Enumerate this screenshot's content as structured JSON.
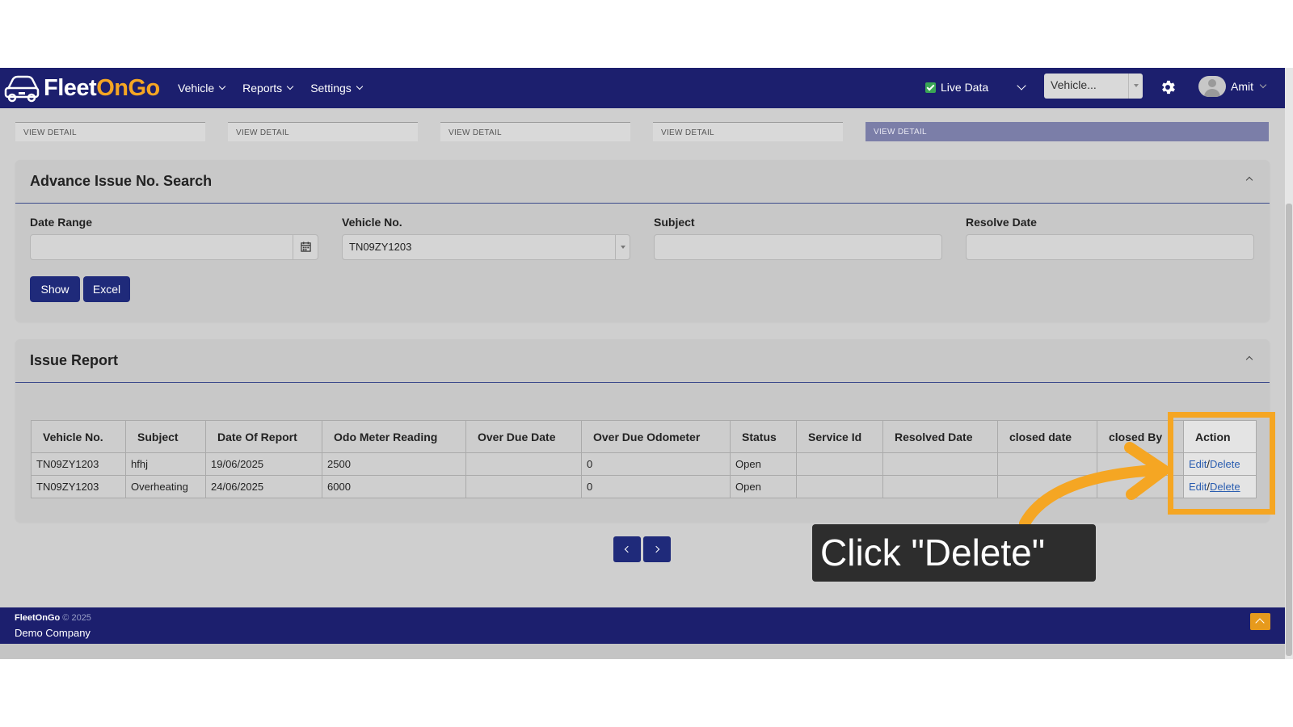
{
  "navbar": {
    "brand_part1": "Fleet",
    "brand_part2": "OnGo",
    "menu": [
      {
        "label": "Vehicle"
      },
      {
        "label": "Reports"
      },
      {
        "label": "Settings"
      }
    ],
    "live_data_label": "Live Data",
    "live_data_checked": true,
    "vehicle_select_value": "Vehicle...",
    "user_name": "Amit"
  },
  "view_detail_tabs": [
    {
      "label": "VIEW DETAIL",
      "active": false
    },
    {
      "label": "VIEW DETAIL",
      "active": false
    },
    {
      "label": "VIEW DETAIL",
      "active": false
    },
    {
      "label": "VIEW DETAIL",
      "active": false
    },
    {
      "label": "VIEW DETAIL",
      "active": true
    }
  ],
  "search": {
    "title": "Advance Issue No. Search",
    "date_range_label": "Date Range",
    "date_range_value": "",
    "vehicle_label": "Vehicle No.",
    "vehicle_value": "TN09ZY1203",
    "subject_label": "Subject",
    "subject_value": "",
    "resolve_label": "Resolve Date",
    "resolve_value": "",
    "show_label": "Show",
    "excel_label": "Excel"
  },
  "report": {
    "title": "Issue Report",
    "columns": [
      "Vehicle No.",
      "Subject",
      "Date Of Report",
      "Odo Meter Reading",
      "Over Due Date",
      "Over Due Odometer",
      "Status",
      "Service Id",
      "Resolved Date",
      "closed date",
      "closed By",
      "Action"
    ],
    "rows": [
      {
        "vehicle": "TN09ZY1203",
        "subject": "hfhj",
        "date": "19/06/2025",
        "odo": "2500",
        "overdue_date": "",
        "overdue_odo": "0",
        "status": "Open",
        "service_id": "",
        "resolved": "",
        "closed_date": "",
        "closed_by": "",
        "edit": "Edit",
        "sep": "/",
        "delete": "Delete"
      },
      {
        "vehicle": "TN09ZY1203",
        "subject": "Overheating",
        "date": "24/06/2025",
        "odo": "6000",
        "overdue_date": "",
        "overdue_odo": "0",
        "status": "Open",
        "service_id": "",
        "resolved": "",
        "closed_date": "",
        "closed_by": "",
        "edit": "Edit",
        "sep": "/",
        "delete": "Delete"
      }
    ]
  },
  "footer": {
    "brand": "FleetOnGo",
    "copyright": "© 2025",
    "company": "Demo Company"
  },
  "annotation": {
    "callout_text": "Click \"Delete\"",
    "highlight_color": "#f5a623"
  },
  "colors": {
    "navbar": "#1c1f6e",
    "button": "#1f2a7a",
    "brand_accent": "#f5a623",
    "link": "#2a5db0"
  },
  "icons": [
    "car-logo-icon",
    "check-icon",
    "gear-icon",
    "user-avatar-icon",
    "calendar-icon",
    "chevron-up-icon",
    "chevron-left-icon",
    "chevron-right-icon",
    "scroll-top-icon"
  ]
}
